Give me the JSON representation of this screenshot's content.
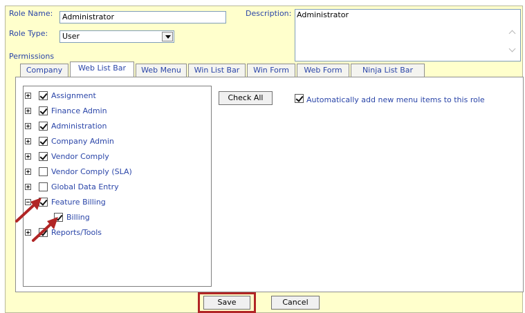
{
  "role_name": {
    "label": "Role Name:",
    "value": "Administrator"
  },
  "description": {
    "label": "Description:",
    "value": "Administrator"
  },
  "role_type": {
    "label": "Role Type:",
    "value": "User"
  },
  "permissions_label": "Permissions",
  "tabs": [
    {
      "label": "Company",
      "active": false
    },
    {
      "label": "Web List Bar",
      "active": true
    },
    {
      "label": "Web Menu",
      "active": false
    },
    {
      "label": "Win List Bar",
      "active": false
    },
    {
      "label": "Win Form",
      "active": false
    },
    {
      "label": "Web Form",
      "active": false
    },
    {
      "label": "Ninja List Bar",
      "active": false
    }
  ],
  "tree": [
    {
      "label": "Assignment",
      "checked": true,
      "expander": "plus"
    },
    {
      "label": "Finance Admin",
      "checked": true,
      "expander": "plus"
    },
    {
      "label": "Administration",
      "checked": true,
      "expander": "plus"
    },
    {
      "label": "Company Admin",
      "checked": true,
      "expander": "plus"
    },
    {
      "label": "Vendor Comply",
      "checked": true,
      "expander": "plus"
    },
    {
      "label": "Vendor Comply (SLA)",
      "checked": false,
      "expander": "plus"
    },
    {
      "label": "Global Data Entry",
      "checked": false,
      "expander": "plus"
    },
    {
      "label": "Feature Billing",
      "checked": true,
      "expander": "minus"
    },
    {
      "label": "Billing",
      "checked": true,
      "expander": "none"
    },
    {
      "label": "Reports/Tools",
      "checked": true,
      "expander": "plus"
    }
  ],
  "check_all_label": "Check All",
  "auto_add": {
    "label": "Automatically add new menu items to this role",
    "checked": true
  },
  "footer": {
    "save_label": "Save",
    "cancel_label": "Cancel"
  },
  "colors": {
    "panel": "#ffffcc",
    "label_blue": "#2a45a8",
    "annotation_red": "#b12525"
  }
}
